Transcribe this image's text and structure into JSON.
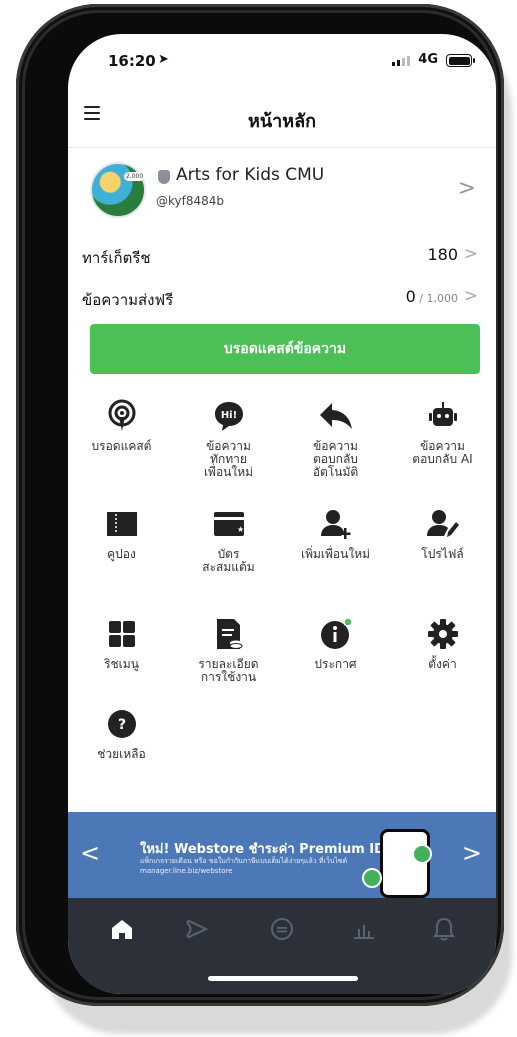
{
  "status_bar": {
    "time": "16:20",
    "network": "4G"
  },
  "header": {
    "title": "หน้าหลัก"
  },
  "account": {
    "name": "Arts for Kids CMU",
    "id": "@kyf8484b",
    "avatar_badge": "2,000"
  },
  "stats": [
    {
      "label": "ทาร์เก็ตรีช",
      "value": "180",
      "suffix": ""
    },
    {
      "label": "ข้อความส่งฟรี",
      "value": "0",
      "suffix": " / 1,000"
    }
  ],
  "broadcast_button": {
    "label": "บรอดแคสต์ข้อความ"
  },
  "menu": [
    {
      "label": "บรอดแคสต์",
      "icon": "broadcast-icon"
    },
    {
      "label": "ข้อความ\nทักทาย\nเพื่อนใหม่",
      "icon": "greeting-message-icon"
    },
    {
      "label": "ข้อความ\nตอบกลับ\nอัตโนมัติ",
      "icon": "auto-reply-icon"
    },
    {
      "label": "ข้อความ\nตอบกลับ AI",
      "icon": "ai-reply-icon"
    },
    {
      "label": "คูปอง",
      "icon": "coupon-icon"
    },
    {
      "label": "บัตร\nสะสมแต้ม",
      "icon": "reward-card-icon"
    },
    {
      "label": "เพิ่มเพื่อนใหม่",
      "icon": "add-friend-icon"
    },
    {
      "label": "โปรไฟล์",
      "icon": "profile-icon"
    },
    {
      "label": "ริชเมนู",
      "icon": "rich-menu-icon"
    },
    {
      "label": "รายละเอียด\nการใช้งาน",
      "icon": "usage-details-icon"
    },
    {
      "label": "ประกาศ",
      "icon": "announcement-icon"
    },
    {
      "label": "ตั้งค่า",
      "icon": "settings-icon"
    },
    {
      "label": "ช่วยเหลือ",
      "icon": "help-icon"
    }
  ],
  "banner": {
    "title": "ใหม่! Webstore ชำระค่า Premium ID",
    "subtitle": "แพ็กเกจรายเดือน หรือ ขอใบกำกับภาษีแบบเต็มได้ง่ายๆแล้ว ที่เว็บไซต์ manager.line.biz/webstore"
  },
  "tabs": [
    "home-tab",
    "voom-tab",
    "chat-tab",
    "insight-tab",
    "notification-tab"
  ],
  "colors": {
    "green": "#4cbf57",
    "banner": "#4c78b7",
    "tabbar": "#2c3139"
  }
}
